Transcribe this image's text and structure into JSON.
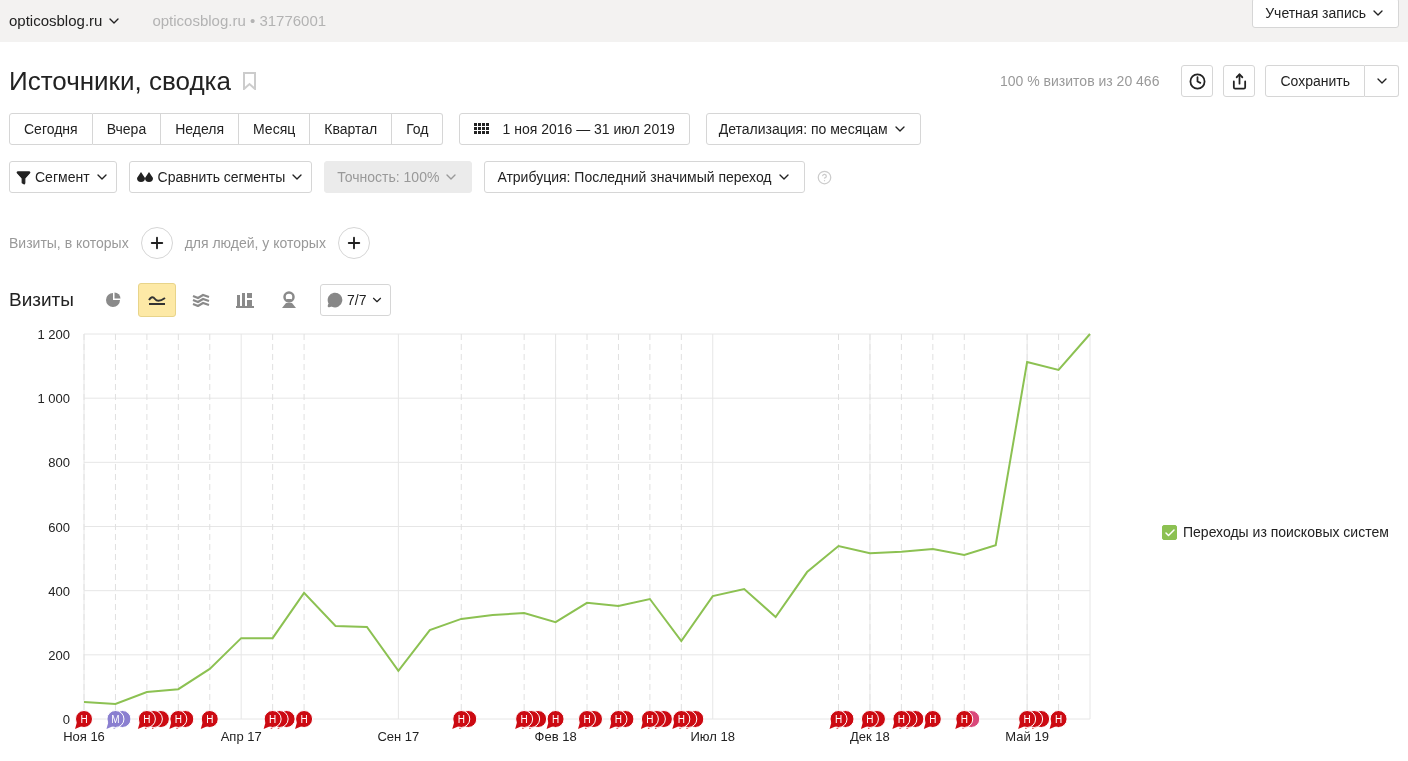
{
  "top_bar": {
    "site": "opticosblog.ru",
    "counter": "opticosblog.ru • 31776001",
    "account": "Учетная запись"
  },
  "header": {
    "title": "Источники, сводка",
    "visits_share": "100 % визитов из 20 466",
    "save": "Сохранить"
  },
  "periods": [
    "Сегодня",
    "Вчера",
    "Неделя",
    "Месяц",
    "Квартал",
    "Год"
  ],
  "date_range": "1 ноя 2016 — 31 июл 2019",
  "detail": "Детализация: по месяцам",
  "filters": [
    {
      "kind": "segment",
      "label": "Сегмент",
      "disabled": false
    },
    {
      "kind": "compare",
      "label": "Сравнить сегменты",
      "disabled": false
    },
    {
      "kind": "accuracy",
      "label": "Точность: 100%",
      "disabled": true
    },
    {
      "kind": "attribution",
      "label": "Атрибуция: Последний значимый переход",
      "disabled": false
    }
  ],
  "conditions": [
    "Визиты, в которых",
    "для людей, у которых"
  ],
  "chart_header": {
    "title": "Визиты",
    "chart_types": [
      {
        "kind": "pie",
        "selected": false
      },
      {
        "kind": "line",
        "selected": true
      },
      {
        "kind": "area",
        "selected": false
      },
      {
        "kind": "bar",
        "selected": false
      },
      {
        "kind": "map",
        "selected": false
      }
    ],
    "notes": "7/7"
  },
  "chart_data": {
    "type": "line",
    "grid": true,
    "ylim": [
      0,
      1200
    ],
    "categories": [
      "Ноя 16",
      null,
      null,
      null,
      null,
      "Апр 17",
      null,
      null,
      null,
      null,
      "Сен 17",
      null,
      null,
      null,
      null,
      "Фев 18",
      null,
      null,
      null,
      null,
      "Июл 18",
      null,
      null,
      null,
      null,
      "Дек 18",
      null,
      null,
      null,
      null,
      "Май 19",
      null,
      null
    ],
    "yticks": [
      {
        "value": 0,
        "label": "0"
      },
      {
        "value": 200,
        "label": "200"
      },
      {
        "value": 400,
        "label": "400"
      },
      {
        "value": 600,
        "label": "600"
      },
      {
        "value": 800,
        "label": "800"
      },
      {
        "value": 1000,
        "label": "1 000"
      },
      {
        "value": 1200,
        "label": "1 200"
      }
    ],
    "series": [
      {
        "name": "Переходы из поисковых систем",
        "color": "#8cc152",
        "values": [
          53,
          47,
          84,
          93,
          156,
          252,
          252,
          393,
          290,
          287,
          150,
          277,
          312,
          324,
          330,
          302,
          362,
          352,
          374,
          243,
          383,
          405,
          318,
          458,
          539,
          517,
          521,
          530,
          511,
          542,
          1113,
          1088,
          1200
        ]
      }
    ]
  },
  "note_months": [
    {
      "markers": [
        {
          "text": "Н",
          "color": "#cc0a12"
        }
      ]
    },
    {
      "markers": [
        {
          "text": "М",
          "color": "#8a7fd0"
        },
        {
          "color": "#8a7fd0"
        }
      ]
    },
    {
      "markers": [
        {
          "text": "Н",
          "color": "#cc0a12"
        },
        {
          "color": "#cc0a12"
        },
        {
          "color": "#cc0a12"
        }
      ]
    },
    {
      "markers": [
        {
          "text": "Н",
          "color": "#cc0a12"
        },
        {
          "color": "#cc0a12"
        }
      ]
    },
    {
      "markers": [
        {
          "text": "Н",
          "color": "#cc0a12"
        }
      ]
    },
    {
      "kind": "empty"
    },
    {
      "markers": [
        {
          "text": "Н",
          "color": "#cc0a12"
        },
        {
          "color": "#cc0a12"
        },
        {
          "color": "#cc0a12"
        }
      ]
    },
    {
      "markers": [
        {
          "text": "Н",
          "color": "#cc0a12"
        }
      ]
    },
    {
      "kind": "empty"
    },
    {
      "kind": "empty"
    },
    {
      "kind": "empty"
    },
    {
      "kind": "empty"
    },
    {
      "markers": [
        {
          "text": "Н",
          "color": "#cc0a12"
        },
        {
          "color": "#cc0a12"
        }
      ]
    },
    {
      "kind": "empty"
    },
    {
      "markers": [
        {
          "text": "Н",
          "color": "#cc0a12"
        },
        {
          "color": "#cc0a12"
        },
        {
          "color": "#cc0a12"
        }
      ]
    },
    {
      "markers": [
        {
          "text": "Н",
          "color": "#cc0a12"
        }
      ]
    },
    {
      "markers": [
        {
          "text": "Н",
          "color": "#cc0a12"
        },
        {
          "color": "#cc0a12"
        }
      ]
    },
    {
      "markers": [
        {
          "text": "Н",
          "color": "#cc0a12"
        },
        {
          "color": "#cc0a12"
        }
      ]
    },
    {
      "markers": [
        {
          "text": "Н",
          "color": "#cc0a12"
        },
        {
          "color": "#cc0a12"
        },
        {
          "color": "#cc0a12"
        }
      ]
    },
    {
      "markers": [
        {
          "text": "Н",
          "color": "#cc0a12"
        },
        {
          "color": "#cc0a12"
        },
        {
          "color": "#cc0a12"
        }
      ]
    },
    {
      "kind": "empty"
    },
    {
      "kind": "empty"
    },
    {
      "kind": "empty"
    },
    {
      "kind": "empty"
    },
    {
      "markers": [
        {
          "text": "Н",
          "color": "#cc0a12"
        },
        {
          "color": "#cc0a12"
        }
      ]
    },
    {
      "markers": [
        {
          "text": "Н",
          "color": "#cc0a12"
        },
        {
          "color": "#cc0a12"
        }
      ]
    },
    {
      "markers": [
        {
          "text": "Н",
          "color": "#cc0a12"
        },
        {
          "color": "#cc0a12"
        },
        {
          "color": "#cc0a12"
        }
      ]
    },
    {
      "markers": [
        {
          "text": "Н",
          "color": "#cc0a12"
        }
      ]
    },
    {
      "markers": [
        {
          "text": "Н",
          "color": "#cc0a12"
        },
        {
          "color": "#d9487a"
        }
      ]
    },
    {
      "kind": "empty"
    },
    {
      "markers": [
        {
          "text": "Н",
          "color": "#cc0a12"
        },
        {
          "color": "#cc0a12"
        },
        {
          "color": "#cc0a12"
        }
      ]
    },
    {
      "markers": [
        {
          "text": "Н",
          "color": "#cc0a12"
        }
      ]
    }
  ],
  "legend": [
    {
      "checked": true
    }
  ]
}
